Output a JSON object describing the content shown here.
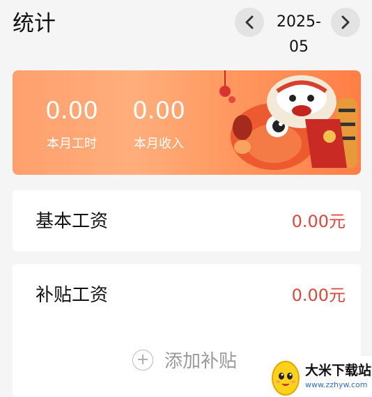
{
  "header": {
    "title": "统计",
    "month": "2025-05",
    "prev_icon": "chevron-left-icon",
    "next_icon": "chevron-right-icon"
  },
  "summary": {
    "hours_value": "0.00",
    "hours_label": "本月工时",
    "income_value": "0.00",
    "income_label": "本月收入",
    "accent": "#ff9a62"
  },
  "basic_salary": {
    "label": "基本工资",
    "value": "0.00元"
  },
  "allowance": {
    "label": "补贴工资",
    "value": "0.00元",
    "add_label": "添加补贴"
  },
  "watermark": {
    "title": "大米下载站",
    "url": "www.zzhyw.com"
  },
  "colors": {
    "value_red": "#e0473c",
    "background": "#f5f5f5"
  }
}
